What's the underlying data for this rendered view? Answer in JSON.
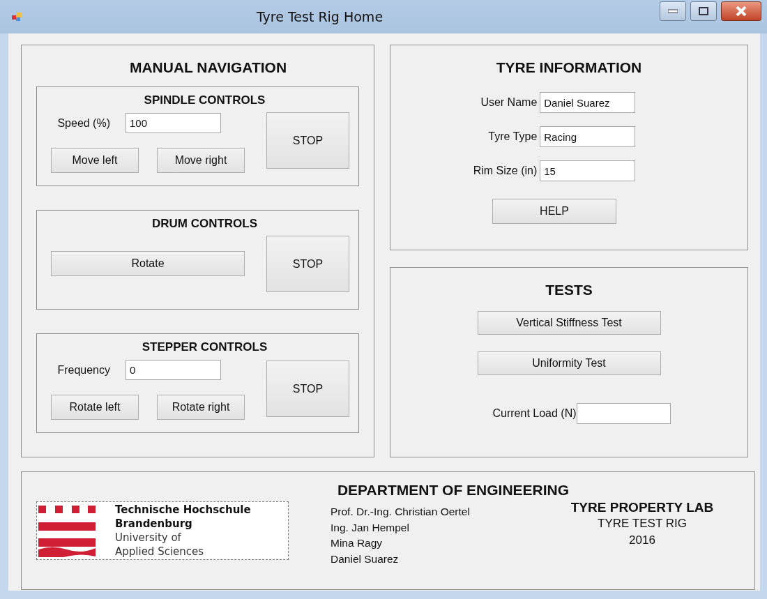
{
  "window": {
    "title": "Tyre Test Rig Home"
  },
  "manual_navigation": {
    "title": "MANUAL NAVIGATION",
    "groups": [
      {
        "kind": "field",
        "title": "SPINDLE CONTROLS",
        "field": {
          "label": "Speed (%)",
          "value": "100"
        },
        "buttons": [
          "Move left",
          "Move right"
        ],
        "stop": "STOP"
      },
      {
        "kind": "single",
        "title": "DRUM CONTROLS",
        "buttons": [
          "Rotate"
        ],
        "stop": "STOP"
      },
      {
        "kind": "field",
        "title": "STEPPER CONTROLS",
        "field": {
          "label": "Frequency",
          "value": "0"
        },
        "buttons": [
          "Rotate left",
          "Rotate right"
        ],
        "stop": "STOP"
      }
    ]
  },
  "tyre_information": {
    "title": "TYRE INFORMATION",
    "fields": [
      {
        "label": "User Name",
        "value": "Daniel Suarez"
      },
      {
        "label": "Tyre Type",
        "value": "Racing"
      },
      {
        "label": "Rim Size (in)",
        "value": "15"
      }
    ],
    "button": "HELP"
  },
  "tests": {
    "title": "TESTS",
    "buttons": [
      "Vertical Stiffness Test",
      "Uniformity Test"
    ],
    "field": {
      "label": "Current Load (N)"
    }
  },
  "footer": {
    "title": "DEPARTMENT OF ENGINEERING",
    "logo": {
      "lines": [
        {
          "text": "Technische Hochschule",
          "bold": true
        },
        {
          "text": "Brandenburg",
          "bold": true
        },
        {
          "text": "University of",
          "bold": false
        },
        {
          "text": "Applied Sciences",
          "bold": false
        }
      ]
    },
    "credits": [
      "Prof. Dr.-Ing. Christian Oertel",
      "Ing. Jan Hempel",
      "Mina Ragy",
      "Daniel Suarez"
    ],
    "lab": {
      "title": "TYRE PROPERTY LAB",
      "subtitle": "TYRE TEST RIG",
      "year": "2016"
    }
  }
}
